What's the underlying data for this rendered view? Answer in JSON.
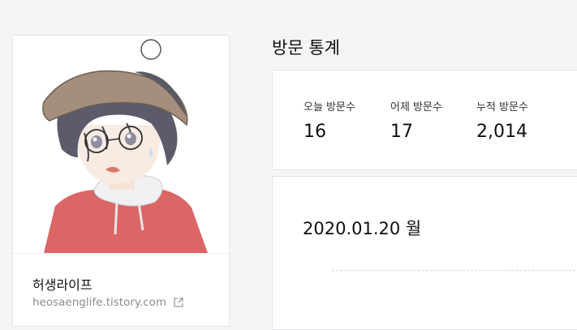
{
  "profile": {
    "blog_name": "허생라이프",
    "blog_url": "heosaenglife.tistory.com",
    "avatar_icon": "avatar-illustration"
  },
  "stats": {
    "title": "방문 통계",
    "items": [
      {
        "label": "오늘 방문수",
        "value": "16"
      },
      {
        "label": "어제 방문수",
        "value": "17"
      },
      {
        "label": "누적 방문수",
        "value": "2,014"
      }
    ]
  },
  "calendar": {
    "date": "2020.01.20 월"
  },
  "colors": {
    "background": "#f4f5f7",
    "card": "#ffffff",
    "border": "#e3e4e8",
    "text": "#111111",
    "muted": "#8b8b8b"
  }
}
